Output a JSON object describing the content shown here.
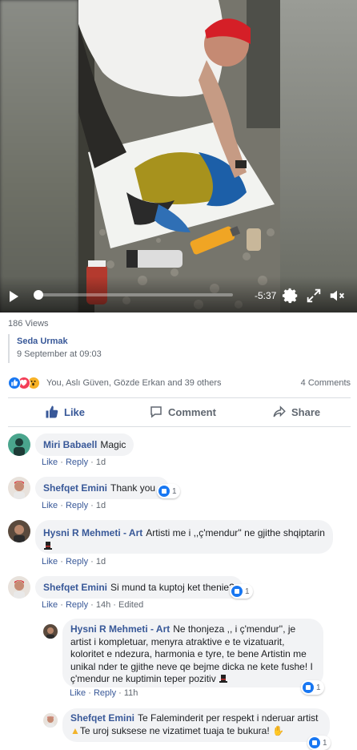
{
  "video": {
    "time_remaining": "-5:37",
    "icons": [
      "play-icon",
      "gear-icon",
      "expand-icon",
      "mute-icon"
    ]
  },
  "post": {
    "views": "186 Views",
    "shared_from": "Seda Urmak",
    "shared_date": "9 September at 09:03",
    "reactions": [
      "like",
      "love",
      "wow"
    ],
    "reactors": "You, Aslı Güven, Gözde Erkan and 39 others",
    "comment_count": "4 Comments"
  },
  "actions": {
    "like": "Like",
    "comment": "Comment",
    "share": "Share"
  },
  "comments": [
    {
      "author": "Miri Babaell",
      "text": "Magic",
      "like": "Like",
      "reply": "Reply",
      "time": "1d"
    },
    {
      "author": "Shefqet Emini",
      "text": "Thank you .",
      "like": "Like",
      "reply": "Reply",
      "time": "1d",
      "reaction_count": "1"
    },
    {
      "author": "Hysni R Mehmeti - Art",
      "text": "Artisti me i ,,ç'mendur'' ne gjithe shqiptarin",
      "like": "Like",
      "reply": "Reply",
      "time": "1d"
    },
    {
      "author": "Shefqet Emini",
      "text": "Si mund ta kuptoj ket thenie?",
      "like": "Like",
      "reply": "Reply",
      "time": "14h",
      "edited": "Edited",
      "reaction_count": "1"
    }
  ],
  "replies": [
    {
      "author": "Hysni R Mehmeti - Art",
      "text": "Ne thonjeza ,, i ç'mendur'', je artist i kompletuar, menyra atraktive e te vizatuarit, koloritet e ndezura, harmonia e tyre, te bene Artistin me unikal nder te gjithe neve qe bejme dicka ne kete fushe! I ç'mendur ne kuptimin teper pozitiv",
      "like": "Like",
      "reply": "Reply",
      "time": "11h",
      "reaction_count": "1"
    },
    {
      "author": "Shefqet Emini",
      "text": "Te Faleminderit per respekt i nderuar artist",
      "text2": "Te uroj suksese ne vizatimet tuaja te bukura!",
      "reaction_count": "1"
    }
  ],
  "colors": {
    "link": "#385898",
    "like_blue": "#1877f2",
    "bubble": "#f2f3f5",
    "meta": "#606770"
  }
}
